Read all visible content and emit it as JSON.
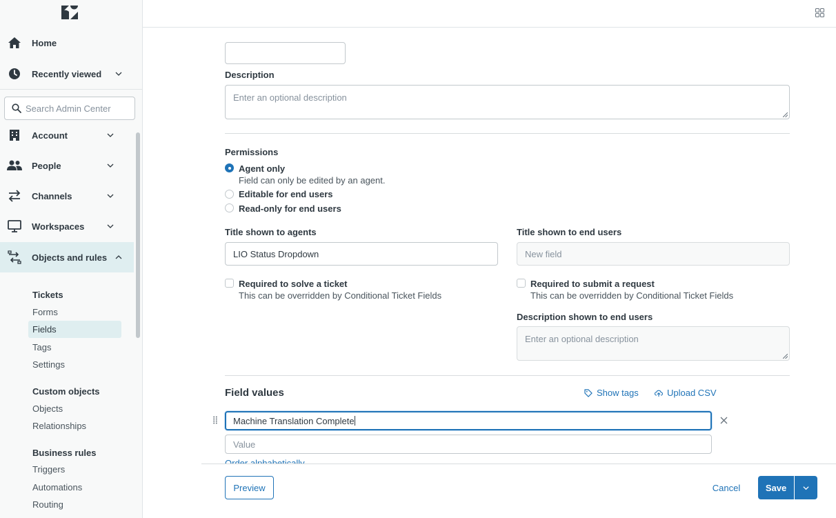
{
  "sidebar": {
    "logo": "zendesk-logo",
    "home": "Home",
    "recently_viewed": "Recently viewed",
    "search_placeholder": "Search Admin Center",
    "account": "Account",
    "people": "People",
    "channels": "Channels",
    "workspaces": "Workspaces",
    "objects_and_rules": "Objects and rules",
    "tickets_head": "Tickets",
    "tickets_items": [
      "Forms",
      "Fields",
      "Tags",
      "Settings"
    ],
    "custom_objects_head": "Custom objects",
    "custom_objects_items": [
      "Objects",
      "Relationships"
    ],
    "business_rules_head": "Business rules",
    "business_rules_items": [
      "Triggers",
      "Automations",
      "Routing"
    ],
    "selected_item": "Fields"
  },
  "form": {
    "description_label": "Description",
    "description_placeholder": "Enter an optional description",
    "permissions_label": "Permissions",
    "permissions": [
      {
        "label": "Agent only",
        "hint": "Field can only be edited by an agent.",
        "checked": true
      },
      {
        "label": "Editable for end users",
        "checked": false
      },
      {
        "label": "Read-only for end users",
        "checked": false
      }
    ],
    "title_agents_label": "Title shown to agents",
    "title_agents_value": "LIO Status Dropdown",
    "title_end_users_label": "Title shown to end users",
    "title_end_users_placeholder": "New field",
    "required_solve_label": "Required to solve a ticket",
    "required_solve_hint": "This can be overridden by Conditional Ticket Fields",
    "required_submit_label": "Required to submit a request",
    "required_submit_hint": "This can be overridden by Conditional Ticket Fields",
    "desc_end_users_label": "Description shown to end users",
    "desc_end_users_placeholder": "Enter an optional description"
  },
  "field_values": {
    "heading": "Field values",
    "show_tags": "Show tags",
    "upload_csv": "Upload CSV",
    "value_1": "Machine Translation Complete",
    "value_placeholder": "Value",
    "order_alpha": "Order alphabetically"
  },
  "footer": {
    "preview": "Preview",
    "cancel": "Cancel",
    "save": "Save"
  },
  "colors": {
    "accent": "#1f73b7",
    "text": "#2f3941",
    "sidebar_bg": "#f8f9f9",
    "selected_bg": "#dfeef0"
  }
}
